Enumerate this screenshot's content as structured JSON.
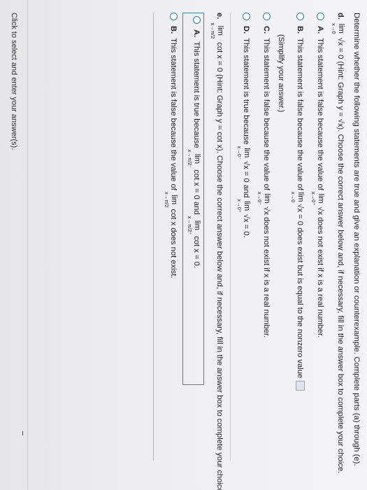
{
  "question": {
    "intro": "Determine whether the following statements are true and give an explanation or counterexample. Complete parts (a) through (e)."
  },
  "part_d": {
    "label": "d.",
    "prompt_lim": "lim",
    "prompt_sub": "x→0",
    "prompt_text": "√x = 0 (Hint: Graph y = √x). Choose the correct answer below and, if necessary, fill in the answer box to complete your choice.",
    "choices": [
      {
        "letter": "A.",
        "text_before": "This statement is false because the value of",
        "lim": "lim",
        "sub": "x→0⁺",
        "text_after": "√x does not exist if x is a real number."
      },
      {
        "letter": "B.",
        "text_before": "This statement is false because the value of",
        "lim": "lim",
        "sub": "x→0",
        "text_after": "√x = 0 does exist but is equal to the nonzero value",
        "note": "(Simplify your answer.)"
      },
      {
        "letter": "C.",
        "text_before": "This statement is false because the value of",
        "lim": "lim",
        "sub": "x→0⁻",
        "text_after": "√x does not exist if x is a real number."
      },
      {
        "letter": "D.",
        "text_before": "This statement is true because",
        "lim": "lim",
        "sub": "x→0⁻",
        "text_mid": "√x = 0 and",
        "lim2": "lim",
        "sub2": "x→0⁺",
        "text_after": "√x = 0."
      }
    ]
  },
  "part_e": {
    "label": "e.",
    "prompt_lim": "lim",
    "prompt_sub": "x→π/2",
    "prompt_text": "cot x = 0 (Hint: Graph y = cot x). Choose the correct answer below and, if necessary, fill in the answer box to complete your choice.",
    "choices": [
      {
        "letter": "A.",
        "text_before": "This statement is true because",
        "lim": "lim",
        "sub": "x→π/2⁻",
        "text_mid": "cot x = 0 and",
        "lim2": "lim",
        "sub2": "x→π/2⁺",
        "text_after": "cot x = 0."
      },
      {
        "letter": "B.",
        "text_before": "This statement is false because the value of",
        "lim": "lim",
        "sub": "x→π/2",
        "text_after": "cot x does not exist."
      }
    ]
  },
  "footer": {
    "instruction": "Click to select and enter your answer(s)."
  }
}
